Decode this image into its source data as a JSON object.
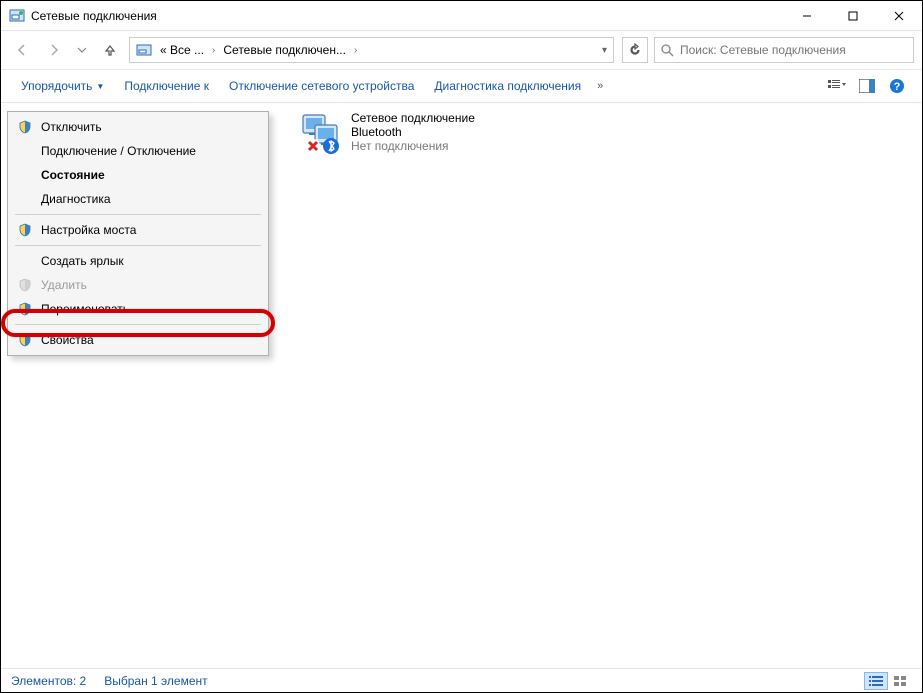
{
  "titlebar": {
    "title": "Сетевые подключения"
  },
  "breadcrumb": {
    "segment1": "« Все ...",
    "segment2": "Сетевые подключен...",
    "dropdown": "▾"
  },
  "search": {
    "placeholder": "Поиск: Сетевые подключения"
  },
  "toolbar": {
    "organize": "Упорядочить",
    "connect": "Подключение к",
    "disable": "Отключение сетевого устройства",
    "diagnose": "Диагностика подключения",
    "overflow": "»"
  },
  "connection": {
    "line1": "Сетевое подключение",
    "line2": "Bluetooth",
    "line3": "Нет подключения"
  },
  "context_menu": {
    "items": [
      {
        "label": "Отключить",
        "shield": true,
        "disabled": false,
        "bold": false
      },
      {
        "label": "Подключение / Отключение",
        "shield": false,
        "disabled": false,
        "bold": false
      },
      {
        "label": "Состояние",
        "shield": false,
        "disabled": false,
        "bold": true
      },
      {
        "label": "Диагностика",
        "shield": false,
        "disabled": false,
        "bold": false
      },
      {
        "sep": true
      },
      {
        "label": "Настройка моста",
        "shield": true,
        "disabled": false,
        "bold": false
      },
      {
        "sep": true
      },
      {
        "label": "Создать ярлык",
        "shield": false,
        "disabled": false,
        "bold": false
      },
      {
        "label": "Удалить",
        "shield": true,
        "disabled": true,
        "bold": false
      },
      {
        "label": "Переименовать",
        "shield": true,
        "disabled": false,
        "bold": false
      },
      {
        "sep": true
      },
      {
        "label": "Свойства",
        "shield": true,
        "disabled": false,
        "bold": false
      }
    ]
  },
  "statusbar": {
    "count_label": "Элементов: 2",
    "selection_label": "Выбран 1 элемент"
  }
}
